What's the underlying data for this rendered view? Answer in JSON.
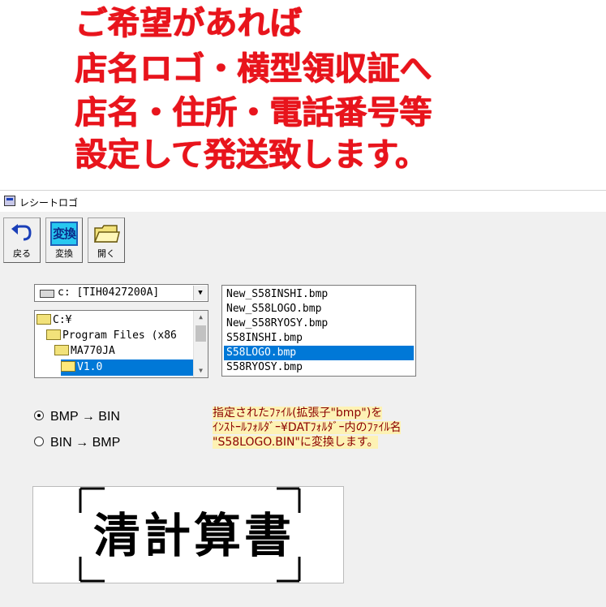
{
  "banner": {
    "lines": [
      "ご希望があれば",
      "店名ロゴ・横型領収証へ",
      "店名・住所・電話番号等",
      "設定して発送致します。"
    ],
    "color": "#e8141c"
  },
  "window": {
    "title": "レシートロゴ"
  },
  "toolbar": {
    "back_label": "戻る",
    "convert_label": "変換",
    "convert_icon_text": "変換",
    "open_label": "開く"
  },
  "drive": {
    "value": "c: [TIH0427200A]"
  },
  "dirs": [
    "C:¥",
    "Program Files (x86",
    "MA770JA",
    "V1.0"
  ],
  "files": [
    "New_S58INSHI.bmp",
    "New_S58LOGO.bmp",
    "New_S58RYOSY.bmp",
    "S58INSHI.bmp",
    "S58LOGO.bmp",
    "S58RYOSY.bmp"
  ],
  "options": {
    "bmp_to_bin": "BMP  →  BIN",
    "bin_to_bmp": "BIN  →  BMP"
  },
  "note": {
    "line1": "指定されたﾌｧｲﾙ(拡張子\"bmp\")を",
    "line2": "ｲﾝｽﾄｰﾙﾌｫﾙﾀﾞｰ¥DATﾌｫﾙﾀﾞｰ内のﾌｧｲﾙ名",
    "line3": "\"S58LOGO.BIN\"に変換します。"
  },
  "preview": {
    "logo_text": "清計算書"
  },
  "colors": {
    "selection": "#0078d7",
    "note_text": "#8b0000",
    "note_highlight": "#fdf2b4"
  }
}
